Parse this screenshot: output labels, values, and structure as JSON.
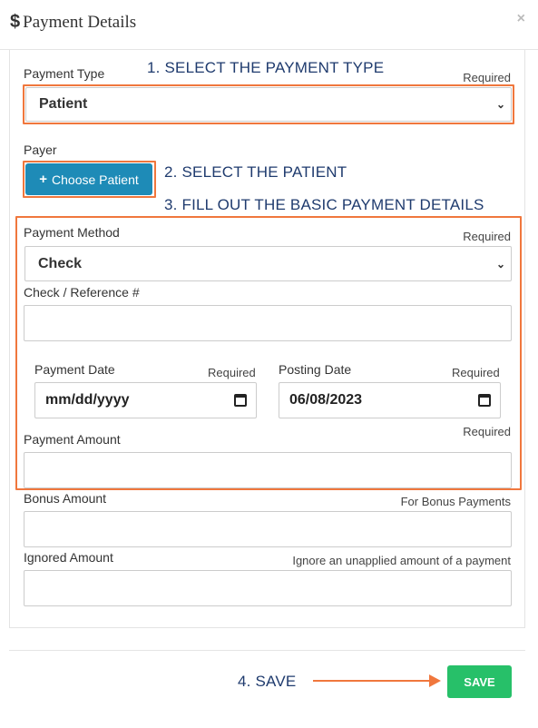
{
  "modal": {
    "title": "Payment Details",
    "close_glyph": "×"
  },
  "payment_type": {
    "label": "Payment Type",
    "required": "Required",
    "value": "Patient"
  },
  "payer": {
    "label": "Payer",
    "button": "Choose Patient"
  },
  "payment_method": {
    "label": "Payment Method",
    "required": "Required",
    "value": "Check"
  },
  "check_reference": {
    "label": "Check / Reference #",
    "value": ""
  },
  "payment_date": {
    "label": "Payment Date",
    "required": "Required",
    "value": "mm/dd/yyyy"
  },
  "posting_date": {
    "label": "Posting Date",
    "required": "Required",
    "value": "06/08/2023"
  },
  "payment_amount": {
    "label": "Payment Amount",
    "required": "Required",
    "value": ""
  },
  "bonus_amount": {
    "label": "Bonus Amount",
    "hint": "For Bonus Payments",
    "value": ""
  },
  "ignored_amount": {
    "label": "Ignored Amount",
    "hint": "Ignore an unapplied amount of a payment",
    "value": ""
  },
  "annotations": {
    "step1": "1. SELECT THE PAYMENT TYPE",
    "step2": "2. SELECT THE PATIENT",
    "step3": "3. FILL OUT THE BASIC PAYMENT DETAILS",
    "step4": "4. SAVE"
  },
  "footer": {
    "save": "SAVE"
  },
  "colors": {
    "accent_orange": "#f0773d",
    "choose_button": "#1e8bb7",
    "save_button": "#27c069",
    "annotation_text": "#1f3b6e"
  }
}
